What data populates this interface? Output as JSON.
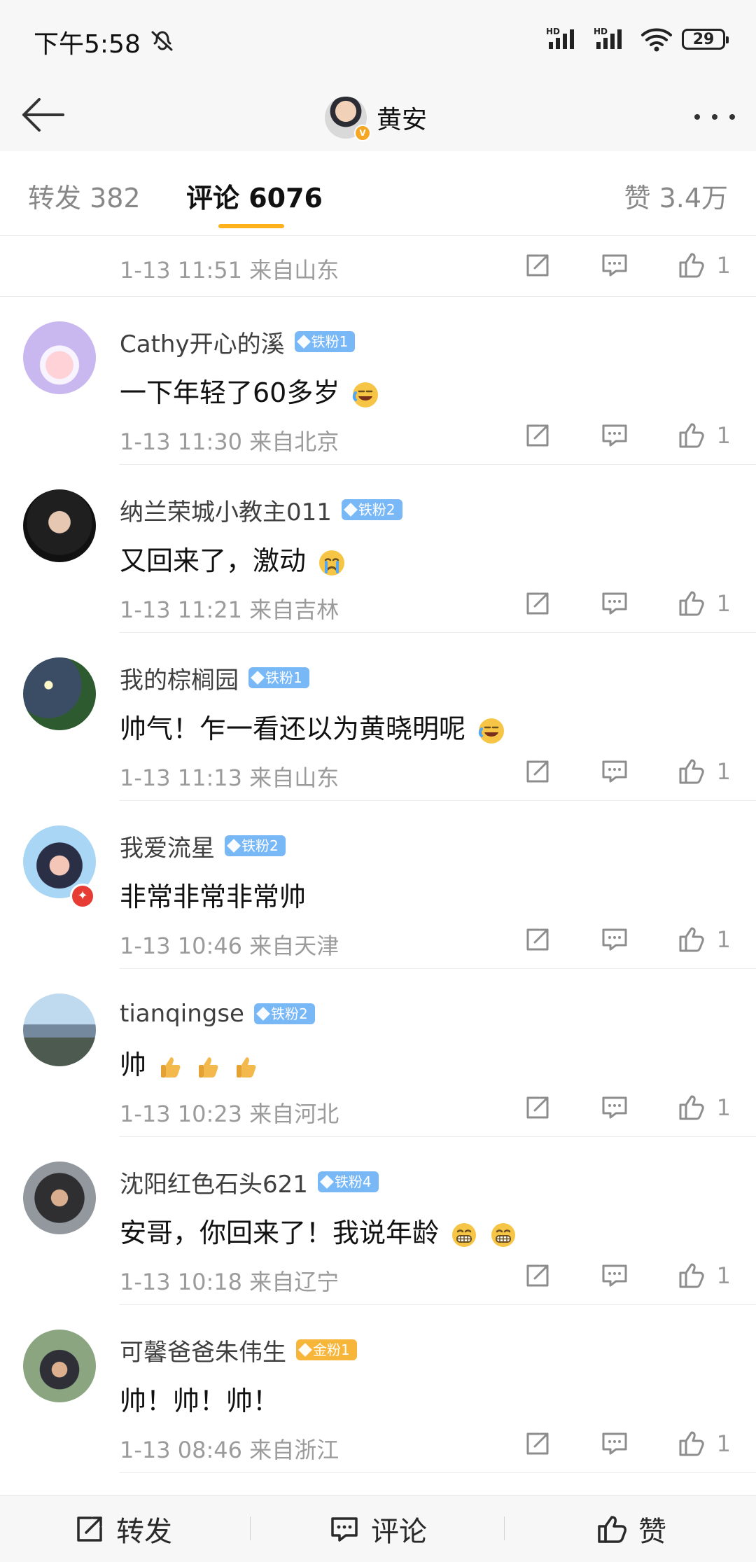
{
  "status_bar": {
    "time": "下午5:58",
    "signal_1": "HD",
    "signal_2": "HD",
    "battery": "29"
  },
  "header": {
    "title": "黄安",
    "avatar_badge": "V"
  },
  "tabs": [
    {
      "label": "转发 382"
    },
    {
      "label": "评论 6076"
    },
    {
      "label": "赞 3.4万"
    }
  ],
  "top_comment_meta": {
    "time_location": "1-13 11:51  来自山东",
    "like_count": "1"
  },
  "comments": [
    {
      "username": "Cathy开心的溪",
      "badge": "铁粉1",
      "text": "一下年轻了60多岁",
      "time_location": "1-13 11:30  来自北京",
      "like_count": "1"
    },
    {
      "username": "纳兰荣城小教主011",
      "badge": "铁粉2",
      "text": "又回来了，激动",
      "time_location": "1-13 11:21  来自吉林",
      "like_count": "1"
    },
    {
      "username": "我的棕榈园",
      "badge": "铁粉1",
      "text": "帅气！乍一看还以为黄晓明呢",
      "time_location": "1-13 11:13  来自山东",
      "like_count": "1"
    },
    {
      "username": "我爱流星",
      "badge": "铁粉2",
      "text": "非常非常非常帅",
      "time_location": "1-13 10:46  来自天津",
      "like_count": "1"
    },
    {
      "username": "tianqingse",
      "badge": "铁粉2",
      "text": "帅",
      "time_location": "1-13 10:23  来自河北",
      "like_count": "1"
    },
    {
      "username": "沈阳红色石头621",
      "badge": "铁粉4",
      "text": "安哥，你回来了！我说年龄",
      "time_location": "1-13 10:18  来自辽宁",
      "like_count": "1"
    },
    {
      "username": "可馨爸爸朱伟生",
      "badge": "金粉1",
      "text": "帅！帅！帅！",
      "time_location": "1-13 08:46  来自浙江",
      "like_count": "1"
    }
  ],
  "bottom_bar": {
    "repost": "转发",
    "comment": "评论",
    "like": "赞"
  },
  "colors": {
    "accent": "#FFB11B",
    "badge_iron": "#78B8F7",
    "badge_gold": "#F7B63A",
    "meta_gray": "#9B9B9B"
  },
  "icons": [
    "mute-icon",
    "signal-icon",
    "wifi-icon",
    "battery-icon",
    "back-arrow-icon",
    "more-icon",
    "share-icon",
    "comment-icon",
    "like-icon"
  ]
}
